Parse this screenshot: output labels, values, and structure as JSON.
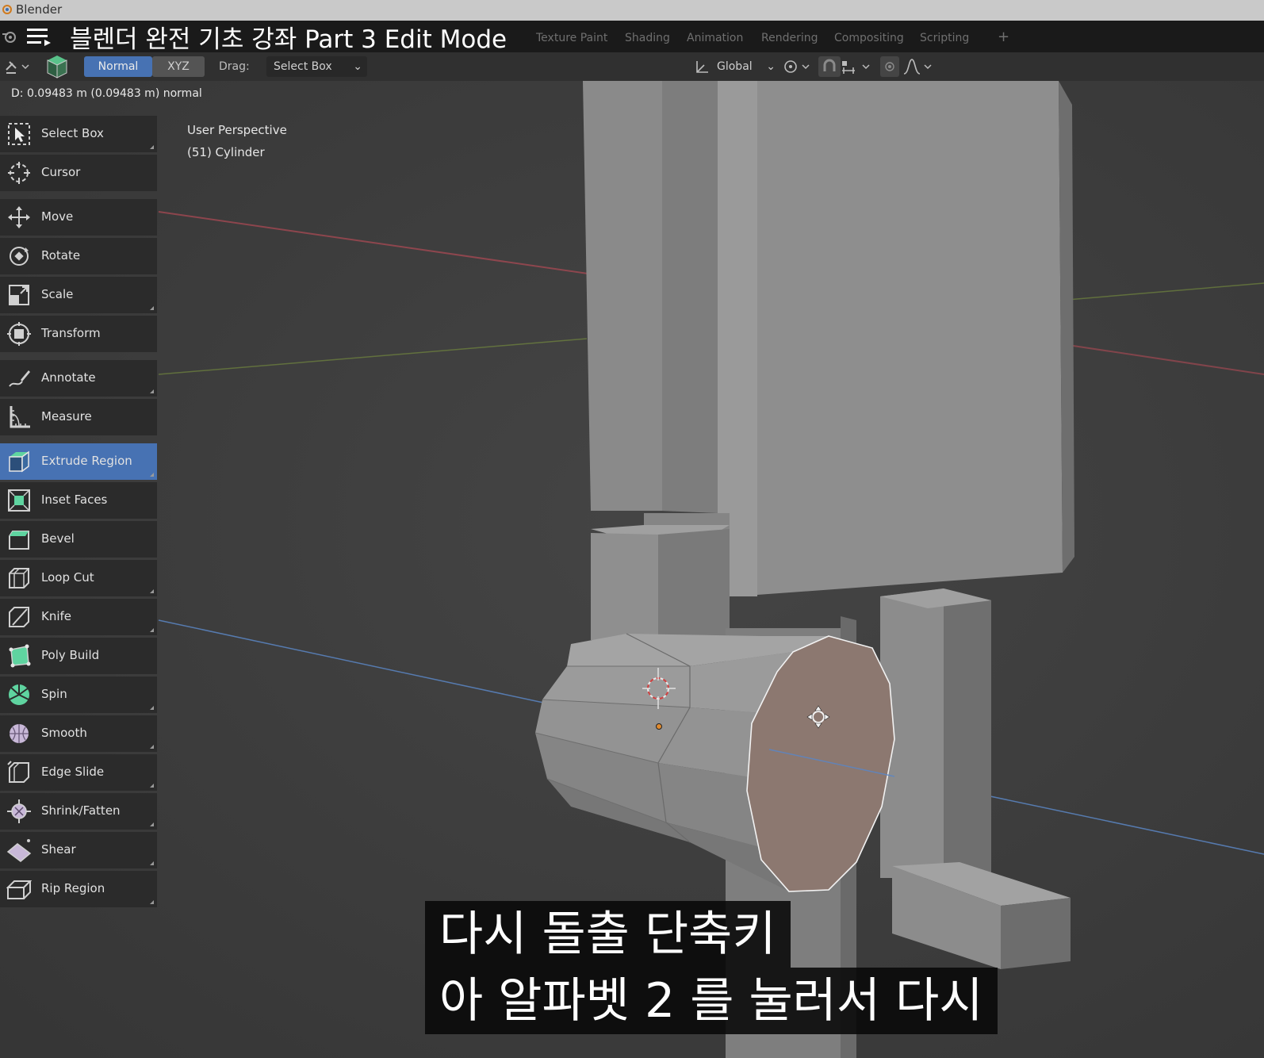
{
  "window": {
    "app_name": "Blender"
  },
  "video": {
    "title": "블렌더 완전 기초 강좌 Part 3 Edit Mode"
  },
  "workspace_tabs": [
    "Texture Paint",
    "Shading",
    "Animation",
    "Rendering",
    "Compositing",
    "Scripting"
  ],
  "header": {
    "orientation_normal": "Normal",
    "orientation_xyz": "XYZ",
    "drag_label": "Drag:",
    "drag_value": "Select Box",
    "transform_orientation": "Global"
  },
  "viewport": {
    "status": "D: 0.09483 m (0.09483 m) normal",
    "perspective": "User Perspective",
    "object": "(51) Cylinder"
  },
  "tools": [
    {
      "label": "Select Box",
      "icon": "select-box-icon"
    },
    {
      "label": "Cursor",
      "icon": "cursor-icon"
    },
    {
      "label": "Move",
      "icon": "move-icon"
    },
    {
      "label": "Rotate",
      "icon": "rotate-icon"
    },
    {
      "label": "Scale",
      "icon": "scale-icon"
    },
    {
      "label": "Transform",
      "icon": "transform-icon"
    },
    {
      "label": "Annotate",
      "icon": "annotate-icon"
    },
    {
      "label": "Measure",
      "icon": "measure-icon"
    },
    {
      "label": "Extrude Region",
      "icon": "extrude-region-icon",
      "active": true
    },
    {
      "label": "Inset Faces",
      "icon": "inset-faces-icon"
    },
    {
      "label": "Bevel",
      "icon": "bevel-icon"
    },
    {
      "label": "Loop Cut",
      "icon": "loop-cut-icon"
    },
    {
      "label": "Knife",
      "icon": "knife-icon"
    },
    {
      "label": "Poly Build",
      "icon": "poly-build-icon"
    },
    {
      "label": "Spin",
      "icon": "spin-icon"
    },
    {
      "label": "Smooth",
      "icon": "smooth-icon"
    },
    {
      "label": "Edge Slide",
      "icon": "edge-slide-icon"
    },
    {
      "label": "Shrink/Fatten",
      "icon": "shrink-fatten-icon"
    },
    {
      "label": "Shear",
      "icon": "shear-icon"
    },
    {
      "label": "Rip Region",
      "icon": "rip-region-icon"
    }
  ],
  "subtitles": {
    "line1": "다시 돌출 단축키",
    "line2": "아 알파벳 2 를 눌러서 다시"
  },
  "colors": {
    "active_tool": "#4772b3",
    "selected_face": "#8c7870",
    "x_axis": "#b04a55",
    "y_axis": "#7f9a3e",
    "blue_line": "#5b86c4"
  }
}
